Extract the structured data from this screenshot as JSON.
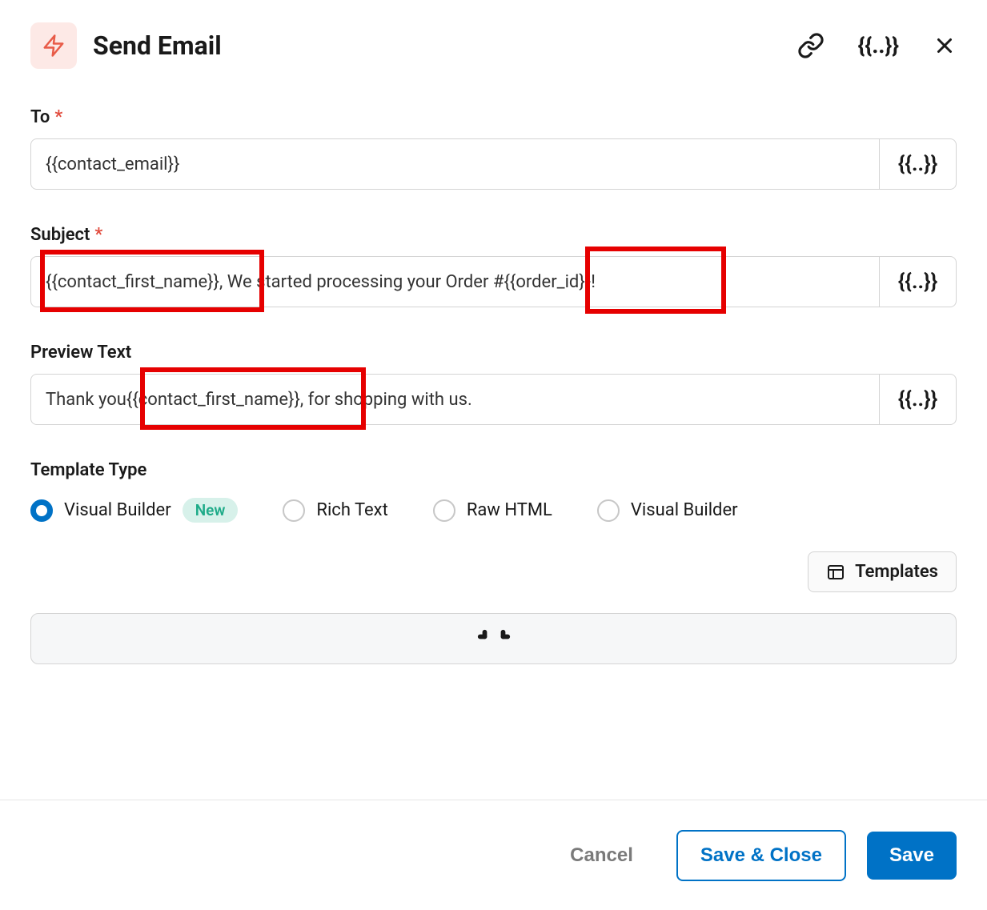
{
  "header": {
    "title": "Send Email"
  },
  "fields": {
    "to": {
      "label": "To",
      "required_marker": "*",
      "value": "{{contact_email}}",
      "var_btn": "{{..}}"
    },
    "subject": {
      "label": "Subject",
      "required_marker": "*",
      "part1": "{{contact_first_name}}",
      "part2": ", We started processing your Order # ",
      "part3": "{{order_id}}",
      "part4": "!",
      "var_btn": "{{..}}"
    },
    "preview": {
      "label": "Preview Text",
      "part1": "Thank you ",
      "part2": "{{contact_first_name}}",
      "part3": ", for shopping with us.",
      "var_btn": "{{..}}"
    }
  },
  "template_type": {
    "label": "Template Type",
    "options": [
      {
        "label": "Visual Builder",
        "badge": "New",
        "selected": true
      },
      {
        "label": "Rich Text",
        "selected": false
      },
      {
        "label": "Raw HTML",
        "selected": false
      },
      {
        "label": "Visual Builder",
        "selected": false
      }
    ]
  },
  "buttons": {
    "templates": "Templates",
    "cancel": "Cancel",
    "save_close": "Save & Close",
    "save": "Save"
  },
  "icons": {
    "variables_header": "{{..}}"
  }
}
